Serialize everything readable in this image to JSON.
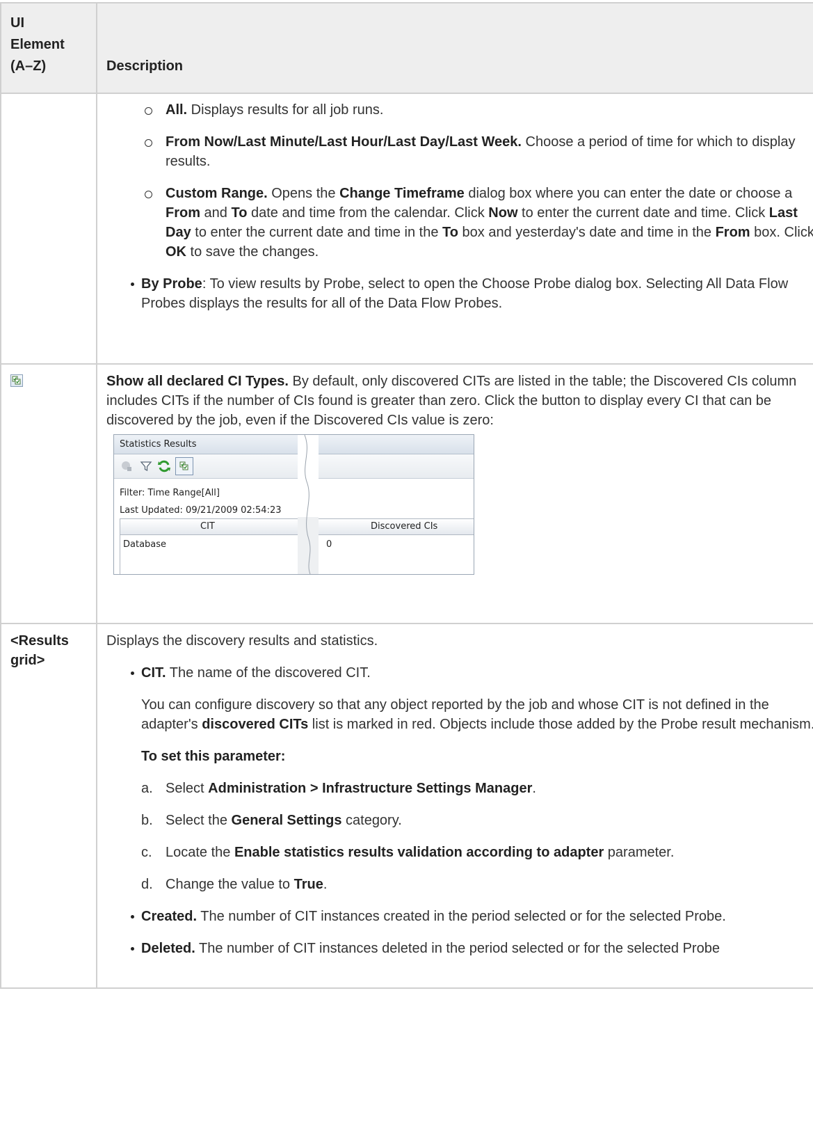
{
  "table": {
    "header": {
      "col1": [
        "UI",
        "Element",
        "(A–Z)"
      ],
      "col2": "Description"
    }
  },
  "row1": {
    "time_options": [
      {
        "bold": "All.",
        "text": " Displays results for all job runs."
      },
      {
        "bold": "From Now/Last Minute/Last Hour/Last Day/Last Week.",
        "text": " Choose a period of time for which to display results."
      }
    ],
    "custom": {
      "b1": "Custom Range.",
      "t1": " Opens the ",
      "b2": "Change Timeframe",
      "t2": " dialog box where you can enter the date or choose a ",
      "b3": "From",
      "t3": " and ",
      "b4": "To",
      "t4": " date and time from the calendar. Click ",
      "b5": "Now",
      "t5": " to enter the current date and time. Click ",
      "b6": "Last Day",
      "t6": " to enter the current date and time in the ",
      "b7": "To",
      "t7": " box and yesterday's date and time in the ",
      "b8": "From",
      "t8": " box. Click ",
      "b9": "OK",
      "t9": " to save the changes."
    },
    "by_probe": {
      "bold": "By Probe",
      "text": ": To view results by Probe, select to open the Choose Probe dialog box. Selecting All Data Flow Probes displays the results for all of the Data Flow Probes."
    }
  },
  "row2": {
    "icon": "show-all-cit-icon",
    "bold": "Show all declared CI Types.",
    "text": " By default, only discovered CITs are listed in the table; the Discovered CIs column includes CITs if the number of CIs found is greater than zero. Click the button to display every CI that can be discovered by the job, even if the Discovered CIs value is zero:",
    "screenshot": {
      "title": "Statistics Results",
      "filter": "Filter: Time Range[All]",
      "updated": "Last Updated: 09/21/2009 02:54:23",
      "col_cit": "CIT",
      "col_discovered": "Discovered CIs",
      "row_name": "Database",
      "row_value": "0"
    }
  },
  "row3": {
    "element": [
      "<Results",
      "grid>"
    ],
    "intro": "Displays the discovery results and statistics.",
    "cit": {
      "bold": "CIT.",
      "text": " The name of the discovered CIT."
    },
    "configure": {
      "t1": "You can configure discovery so that any object reported by the job and whose CIT is not defined in the adapter's ",
      "b1": "discovered CITs",
      "t2": " list is marked in red. Objects include those added by the Probe result mechanism."
    },
    "set_param": "To set this parameter:",
    "steps": [
      {
        "letter": "a.",
        "t1": "Select ",
        "b1": "Administration > Infrastructure Settings Manager",
        "t2": "."
      },
      {
        "letter": "b.",
        "t1": "Select the ",
        "b1": "General Settings",
        "t2": " category."
      },
      {
        "letter": "c.",
        "t1": "Locate the ",
        "b1": "Enable statistics results validation according to adapter",
        "t2": " parameter."
      },
      {
        "letter": "d.",
        "t1": "Change the value to ",
        "b1": "True",
        "t2": "."
      }
    ],
    "created": {
      "bold": "Created.",
      "text": " The number of CIT instances created in the period selected or for the selected Probe."
    },
    "deleted": {
      "bold": "Deleted.",
      "text": " The number of CIT instances deleted in the period selected or for the selected Probe"
    }
  },
  "colors": {
    "border": "#d0d0d0",
    "header_bg": "#eeeeee",
    "text": "#333333"
  }
}
